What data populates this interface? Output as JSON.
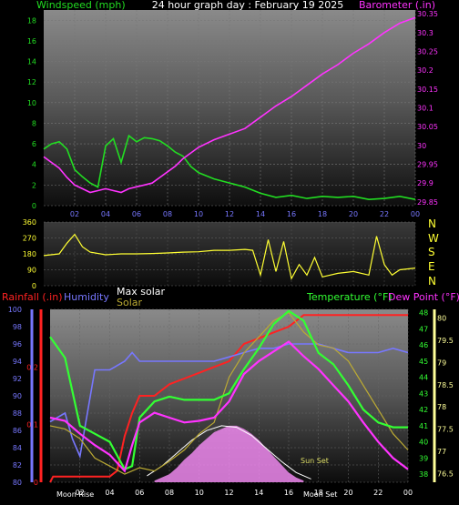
{
  "title": "24 hour graph day : February 19 2025",
  "colors": {
    "background": "#000000",
    "wind": "#22dd22",
    "barometer": "#ff33ff",
    "direction": "#ffff33",
    "rain": "#ff2222",
    "humidity": "#7777ff",
    "maxsolar": "#ffffff",
    "solar": "#bbaa33",
    "temperature": "#33ff33",
    "dewpoint": "#ff33ff",
    "tempaxis": "#ffff99",
    "solarfill": "#ee88ee"
  },
  "labels": {
    "windspeed": "Windspeed (mph)",
    "barometer": "Barometer (.in)",
    "rainfall": "Rainfall (.in)",
    "humidity": "Humidity",
    "maxsolar": "Max solar",
    "solar": "Solar",
    "temperature": "Temperature (°F)",
    "dewpoint": "Dew Point (°F)",
    "moonrise": "Moon Rise",
    "moonset": "Moon Set",
    "sunset": "Sun Set"
  },
  "compass": [
    "N",
    "W",
    "S",
    "E",
    "N"
  ],
  "chart_data": [
    {
      "type": "line",
      "name": "wind-barometer",
      "x_ticks": [
        "02",
        "04",
        "06",
        "08",
        "10",
        "12",
        "14",
        "16",
        "18",
        "20",
        "22",
        "00"
      ],
      "ylim_left": [
        0,
        19
      ],
      "left_ticks": [
        "0",
        "2",
        "4",
        "6",
        "8",
        "10",
        "12",
        "14",
        "16",
        "18"
      ],
      "ylim_right": [
        29.84,
        30.36
      ],
      "right_ticks": [
        "29.85",
        "29.9",
        "29.95",
        "30",
        "30.05",
        "30.1",
        "30.15",
        "30.2",
        "30.25",
        "30.3",
        "30.35"
      ],
      "series": [
        {
          "name": "Windspeed (mph)",
          "x": [
            0,
            0.5,
            1,
            1.5,
            2,
            2.5,
            3,
            3.5,
            4,
            4.5,
            5,
            5.5,
            6,
            6.5,
            7,
            7.5,
            8,
            8.5,
            9,
            9.5,
            10,
            11,
            12,
            13,
            14,
            15,
            16,
            17,
            18,
            19,
            20,
            21,
            22,
            23,
            24
          ],
          "y": [
            5.5,
            6.0,
            6.2,
            5.5,
            3.5,
            2.8,
            2.2,
            1.8,
            5.8,
            6.5,
            4.2,
            6.8,
            6.2,
            6.6,
            6.5,
            6.3,
            5.8,
            5.2,
            4.8,
            3.8,
            3.2,
            2.6,
            2.2,
            1.8,
            1.2,
            0.8,
            1.0,
            0.7,
            0.9,
            0.8,
            0.9,
            0.6,
            0.7,
            0.9,
            0.6
          ]
        },
        {
          "name": "Barometer (.in)",
          "x": [
            0,
            0.5,
            1,
            1.5,
            2,
            2.5,
            3,
            3.5,
            4,
            4.5,
            5,
            5.5,
            6,
            6.5,
            7,
            7.5,
            8,
            8.5,
            9,
            10,
            11,
            12,
            13,
            14,
            15,
            16,
            17,
            18,
            19,
            20,
            21,
            22,
            23,
            24
          ],
          "y": [
            29.97,
            29.955,
            29.94,
            29.915,
            29.895,
            29.885,
            29.875,
            29.88,
            29.885,
            29.88,
            29.875,
            29.885,
            29.89,
            29.895,
            29.9,
            29.915,
            29.93,
            29.945,
            29.965,
            29.995,
            30.015,
            30.03,
            30.045,
            30.075,
            30.105,
            30.13,
            30.16,
            30.19,
            30.215,
            30.245,
            30.27,
            30.3,
            30.325,
            30.34
          ]
        }
      ]
    },
    {
      "type": "line",
      "name": "wind-direction",
      "ylim": [
        0,
        360
      ],
      "y_ticks": [
        "0",
        "90",
        "180",
        "270",
        "360"
      ],
      "series": [
        {
          "name": "Wind direction",
          "x": [
            0,
            1,
            1.5,
            2,
            2.5,
            3,
            4,
            5,
            6,
            7,
            8,
            9,
            10,
            11,
            12,
            13,
            13.5,
            14,
            14.5,
            15,
            15.5,
            16,
            16.5,
            17,
            17.5,
            18,
            19,
            20,
            21,
            21.5,
            22,
            22.5,
            23,
            24
          ],
          "y": [
            170,
            180,
            240,
            290,
            220,
            190,
            175,
            180,
            180,
            182,
            185,
            190,
            192,
            200,
            200,
            205,
            200,
            60,
            260,
            80,
            250,
            40,
            120,
            60,
            160,
            50,
            70,
            80,
            60,
            280,
            120,
            60,
            90,
            100
          ]
        }
      ]
    },
    {
      "type": "line",
      "name": "rain-humidity-temperature",
      "ylim_humidity": [
        80,
        100
      ],
      "humidity_ticks": [
        "80",
        "82",
        "84",
        "86",
        "88",
        "90",
        "92",
        "94",
        "96",
        "98",
        "100"
      ],
      "ylim_rain": [
        0,
        0.3
      ],
      "rain_ticks": [
        "0",
        "0.1",
        "0.2"
      ],
      "ylim_temp": [
        37.5,
        48.2
      ],
      "temp_ticks": [
        "38",
        "39",
        "40",
        "41",
        "42",
        "43",
        "44",
        "45",
        "46",
        "47",
        "48"
      ],
      "ylim_temp_outer": [
        76.3,
        80.2
      ],
      "temp_outer_ticks": [
        "76.5",
        "77",
        "77.5",
        "78",
        "78.5",
        "79",
        "79.5",
        "80"
      ],
      "series": [
        {
          "name": "Rainfall (.in)",
          "x": [
            0,
            0.2,
            1,
            2,
            3,
            4,
            4.5,
            5,
            5.5,
            6,
            7,
            8,
            9,
            10,
            11,
            12,
            13,
            14,
            15,
            16,
            17,
            18,
            19,
            20,
            21,
            22,
            23,
            24
          ],
          "y": [
            0,
            0.01,
            0.01,
            0.01,
            0.01,
            0.01,
            0.02,
            0.08,
            0.12,
            0.15,
            0.15,
            0.17,
            0.18,
            0.19,
            0.2,
            0.21,
            0.24,
            0.25,
            0.26,
            0.27,
            0.29,
            0.29,
            0.29,
            0.29,
            0.29,
            0.29,
            0.29,
            0.29
          ]
        },
        {
          "name": "Humidity",
          "x": [
            0,
            1,
            1.5,
            2,
            3,
            4,
            5,
            5.5,
            6,
            7,
            8,
            9,
            10,
            11,
            12,
            13,
            14,
            15,
            16,
            17,
            18,
            19,
            20,
            21,
            22,
            23,
            24
          ],
          "y": [
            87,
            88,
            85,
            83,
            93,
            93,
            94,
            95,
            94,
            94,
            94,
            94,
            94,
            94,
            94.5,
            95,
            95.5,
            95.5,
            96,
            96,
            96,
            95.5,
            95,
            95,
            95,
            95.5,
            95
          ]
        },
        {
          "name": "Max solar",
          "x": [
            6.5,
            7.5,
            8.5,
            9.5,
            10.5,
            11.5,
            12.5,
            13.5,
            14.5,
            15.5,
            16.5,
            17.5
          ],
          "y": [
            37.9,
            38.5,
            39.3,
            40.1,
            40.7,
            41,
            40.9,
            40.4,
            39.6,
            38.8,
            38.1,
            37.7
          ]
        },
        {
          "name": "Solar",
          "x": [
            0,
            1,
            2,
            3,
            4,
            5,
            6,
            7,
            8,
            9,
            10,
            11,
            12,
            13,
            14,
            15,
            16,
            17,
            18,
            19,
            20,
            21,
            22,
            23,
            24
          ],
          "y": [
            41,
            40.8,
            40.2,
            39,
            38.5,
            38,
            38.4,
            38.2,
            38.8,
            39.5,
            40.5,
            41.2,
            44,
            45.5,
            46.5,
            47.5,
            48,
            46.8,
            46,
            45.8,
            45,
            43.5,
            42,
            40.5,
            39.5
          ]
        },
        {
          "name": "Temperature (°F)",
          "x": [
            0,
            1,
            2,
            3,
            4,
            5,
            5.5,
            6,
            7,
            8,
            9,
            10,
            11,
            12,
            13,
            14,
            15,
            16,
            17,
            18,
            19,
            20,
            21,
            22,
            23,
            24
          ],
          "y": [
            46.5,
            45.2,
            41,
            40.5,
            40,
            38.3,
            38.5,
            41.5,
            42.5,
            42.8,
            42.6,
            42.6,
            42.6,
            43,
            44.5,
            45.8,
            47.3,
            48.1,
            47.5,
            45.5,
            44.8,
            43.5,
            42,
            41.2,
            40.9,
            40.9
          ]
        },
        {
          "name": "Dew Point (°F)",
          "x": [
            0,
            1,
            2,
            3,
            4,
            5,
            5.5,
            6,
            7,
            8,
            9,
            10,
            11,
            12,
            13,
            14,
            15,
            16,
            17,
            18,
            19,
            20,
            21,
            22,
            23,
            24
          ],
          "y": [
            41.5,
            41.3,
            40.5,
            39.8,
            39.2,
            38.2,
            39.8,
            41.2,
            41.8,
            41.5,
            41.2,
            41.3,
            41.5,
            42.5,
            44.2,
            45,
            45.6,
            46.2,
            45.3,
            44.5,
            43.5,
            42.5,
            41.2,
            40,
            39,
            38.3
          ]
        }
      ],
      "solar_radiation": {
        "x": [
          7,
          8,
          8.5,
          9,
          9.5,
          10,
          10.5,
          11,
          11.5,
          12,
          12.5,
          13,
          13.5,
          14,
          14.5,
          15,
          15.5,
          16,
          16.5,
          17
        ],
        "y": [
          37.6,
          38.0,
          38.4,
          38.9,
          39.3,
          39.8,
          40.2,
          40.6,
          40.8,
          41,
          41,
          40.8,
          40.5,
          40.1,
          39.6,
          39.1,
          38.6,
          38.1,
          37.8,
          37.6
        ]
      },
      "x_ticks": [
        "02",
        "04",
        "06",
        "08",
        "10",
        "12",
        "14",
        "16",
        "18",
        "20",
        "22",
        "00"
      ]
    }
  ]
}
